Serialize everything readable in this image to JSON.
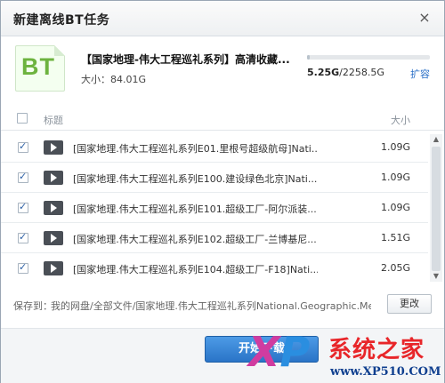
{
  "dialog": {
    "title": "新建离线BT任务",
    "close_label": "×"
  },
  "task": {
    "icon_text": "BT",
    "name": "【国家地理-伟大工程巡礼系列】高清收藏...",
    "size_label": "大小：84.01G",
    "quota_used": "5.25G",
    "quota_total": "/2258.5G",
    "quota_fraction": 0.0023,
    "expand_label": "扩容"
  },
  "list": {
    "header_title": "标题",
    "header_size": "大小",
    "rows": [
      {
        "name": "[国家地理.伟大工程巡礼系列E01.里根号超级航母]Nati...",
        "size": "1.09G",
        "checked": true
      },
      {
        "name": "[国家地理.伟大工程巡礼系列E100.建设绿色北京]Nati...",
        "size": "1.09G",
        "checked": true
      },
      {
        "name": "[国家地理.伟大工程巡礼系列E101.超级工厂-阿尔派装...",
        "size": "1.09G",
        "checked": true
      },
      {
        "name": "[国家地理.伟大工程巡礼系列E102.超级工厂-兰博基尼...",
        "size": "1.51G",
        "checked": true
      },
      {
        "name": "[国家地理.伟大工程巡礼系列E104.超级工厂-F18]Nati...",
        "size": "2.05G",
        "checked": true
      }
    ]
  },
  "save": {
    "label": "保存到：",
    "path": "我的网盘/全部文件/国家地理.伟大工程巡礼系列National.Geographic.Meg...",
    "change_label": "更改"
  },
  "footer": {
    "start_label": "开始下载"
  },
  "watermark": {
    "logo": "XP",
    "site_name": "系统之家",
    "url": "www.XP510.COM"
  }
}
